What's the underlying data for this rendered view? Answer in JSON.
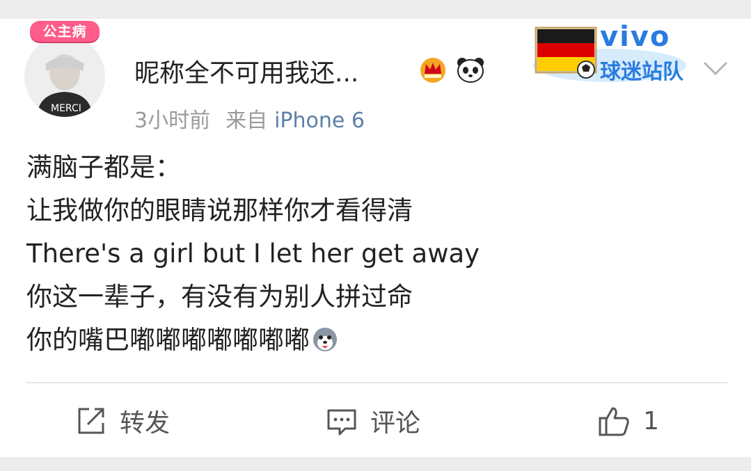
{
  "post": {
    "avatar_badge": "公主病",
    "username": "昵称全不可用我还...",
    "time": "3小时前",
    "source_prefix": "来自",
    "device": "iPhone 6",
    "fan_badge_brand": "vivo",
    "fan_badge_label": "球迷站队",
    "body_lines": [
      "满脑子都是：",
      "让我做你的眼睛说那样你才看得清",
      "There's a girl but I let her get away",
      "你这一辈子，有没有为别人拼过命",
      "你的嘴巴嘟嘟嘟嘟嘟嘟嘟"
    ]
  },
  "actions": {
    "repost_label": "转发",
    "comment_label": "评论",
    "like_count": "1"
  },
  "colors": {
    "background": "#ededed",
    "card": "#ffffff",
    "text": "#222222",
    "meta": "#9a9a9a",
    "device_link": "#5b7fa8",
    "vivo_blue": "#2a7be0",
    "badge_pink": "#ff5c8a"
  },
  "icons": {
    "repost": "repost-icon",
    "comment": "comment-icon",
    "like": "thumbs-up-icon",
    "dropdown": "chevron-down-icon",
    "crown": "crown-icon",
    "panda": "panda-icon",
    "flag": "germany-flag-icon",
    "emoji": "husky-emoji-icon"
  }
}
